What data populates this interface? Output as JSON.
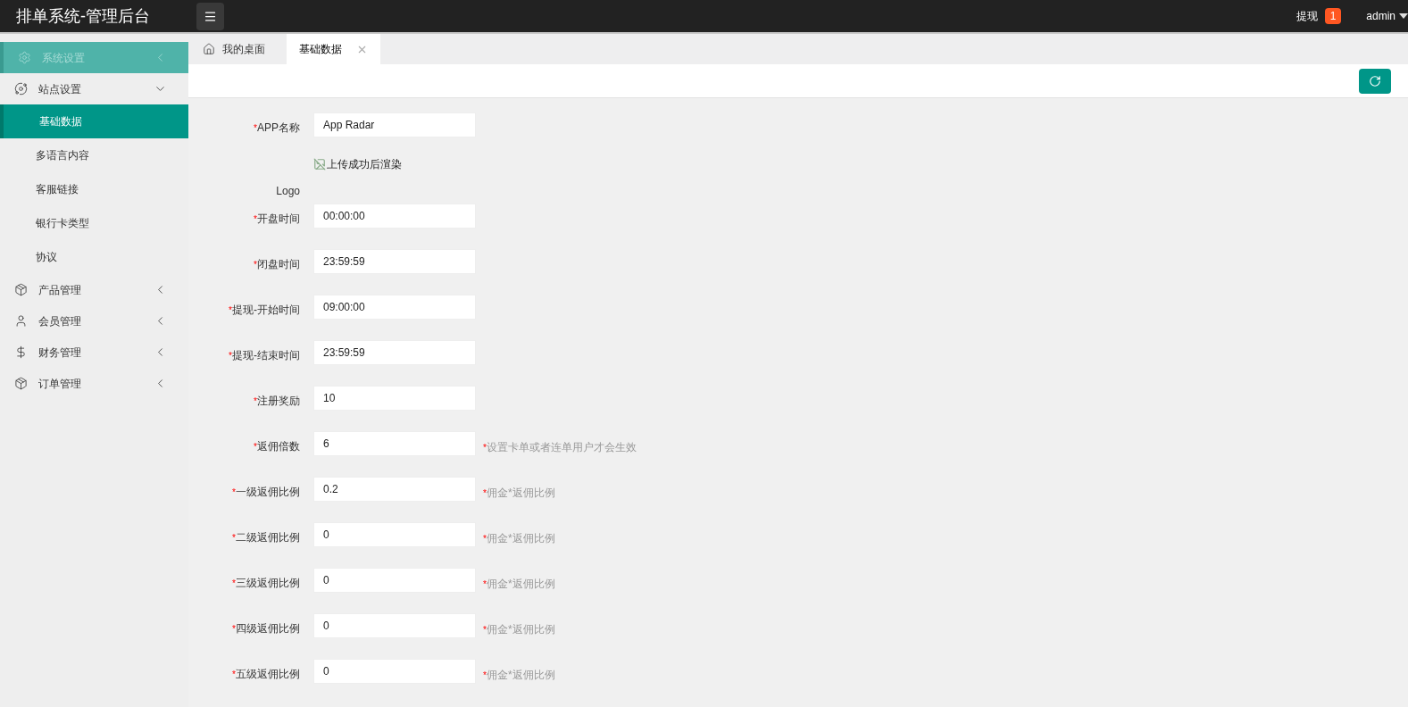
{
  "header": {
    "title": "排单系统-管理后台",
    "withdraw": {
      "label": "提现",
      "count": "1"
    },
    "user": "admin"
  },
  "sidebar": {
    "items": [
      {
        "label": "系统设置",
        "selected": true,
        "expanded": false
      },
      {
        "label": "站点设置",
        "selected": false,
        "expanded": true,
        "children": [
          {
            "label": "基础数据",
            "selected": true
          },
          {
            "label": "多语言内容",
            "selected": false
          },
          {
            "label": "客服链接",
            "selected": false
          },
          {
            "label": "银行卡类型",
            "selected": false
          },
          {
            "label": "协议",
            "selected": false
          }
        ]
      },
      {
        "label": "产品管理",
        "selected": false,
        "expanded": false
      },
      {
        "label": "会员管理",
        "selected": false,
        "expanded": false
      },
      {
        "label": "财务管理",
        "selected": false,
        "expanded": false
      },
      {
        "label": "订单管理",
        "selected": false,
        "expanded": false
      }
    ]
  },
  "tabs": [
    {
      "label": "我的桌面",
      "selected": false,
      "kind": "home"
    },
    {
      "label": "基础数据",
      "selected": true,
      "kind": "closable"
    }
  ],
  "form": {
    "rows": [
      {
        "kind": "input",
        "label": "APP名称",
        "required": true,
        "mark": "*",
        "value": "App Radar"
      },
      {
        "kind": "image",
        "label": "Logo",
        "required": false,
        "alt": "上传成功后渲染"
      },
      {
        "kind": "input",
        "label": "开盘时间",
        "required": true,
        "mark": "*",
        "value": "00:00:00"
      },
      {
        "kind": "input",
        "label": "闭盘时间",
        "required": true,
        "mark": "*",
        "value": "23:59:59"
      },
      {
        "kind": "input",
        "label": "提现-开始时间",
        "required": true,
        "mark": "*",
        "value": "09:00:00"
      },
      {
        "kind": "input",
        "label": "提现-结束时间",
        "required": true,
        "mark": "*",
        "value": "23:59:59"
      },
      {
        "kind": "input",
        "label": "注册奖励",
        "required": true,
        "mark": "*",
        "value": "10"
      },
      {
        "kind": "input",
        "label": "返佣倍数",
        "required": true,
        "mark": "*",
        "value": "6",
        "hint": {
          "mark": "*",
          "text": "设置卡单或者连单用户才会生效"
        }
      },
      {
        "kind": "input",
        "label": "一级返佣比例",
        "required": true,
        "mark": "*",
        "value": "0.2",
        "hint": {
          "mark": "*",
          "text": "佣金*返佣比例"
        }
      },
      {
        "kind": "input",
        "label": "二级返佣比例",
        "required": true,
        "mark": "*",
        "value": "0",
        "hint": {
          "mark": "*",
          "text": "佣金*返佣比例"
        }
      },
      {
        "kind": "input",
        "label": "三级返佣比例",
        "required": true,
        "mark": "*",
        "value": "0",
        "hint": {
          "mark": "*",
          "text": "佣金*返佣比例"
        }
      },
      {
        "kind": "input",
        "label": "四级返佣比例",
        "required": true,
        "mark": "*",
        "value": "0",
        "hint": {
          "mark": "*",
          "text": "佣金*返佣比例"
        }
      },
      {
        "kind": "input",
        "label": "五级返佣比例",
        "required": true,
        "mark": "*",
        "value": "0",
        "hint": {
          "mark": "*",
          "text": "佣金*返佣比例"
        }
      }
    ]
  }
}
